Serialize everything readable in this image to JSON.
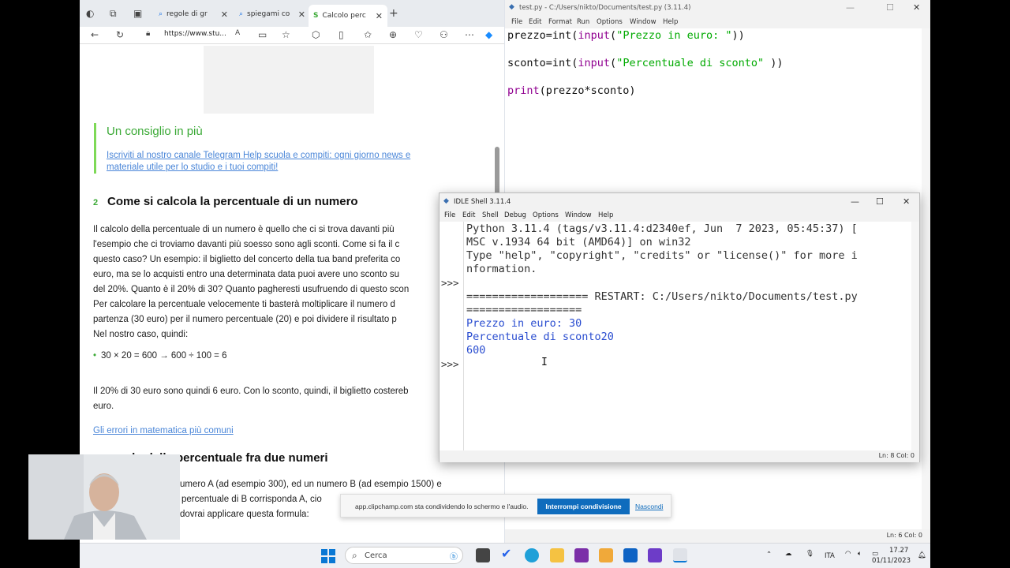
{
  "browser": {
    "tabs": [
      {
        "label": "regole di gr",
        "icon": "search-icon"
      },
      {
        "label": "spiegami co",
        "icon": "search-icon"
      },
      {
        "label": "Calcolo perc",
        "icon": "studenti-logo-icon",
        "active": true
      }
    ],
    "url": "https://www.stu...",
    "article": {
      "tip_title": "Un consiglio in più",
      "tip_link_1": "Iscriviti al nostro canale Telegram Help scuola e compiti: ogni giorno news e",
      "tip_link_2": "materiale utile per lo studio e i tuoi compiti!",
      "section_number": "2",
      "section_title": "Come si calcola la percentuale di un numero",
      "paragraph_lines": [
        "Il calcolo della percentuale di un numero è quello che ci si trova davanti più",
        "l'esempio che ci troviamo davanti più soesso sono agli sconti. Come si fa il c",
        "questo caso? Un esempio: il biglietto del concerto della tua band preferita co",
        "euro, ma se lo acquisti entro una determinata data puoi avere uno sconto su",
        "del 20%. Quanto è il 20% di 30? Quanto pagheresti usufruendo di questo scon",
        "Per calcolare la percentuale velocemente ti basterà moltiplicare il numero d",
        "partenza (30 euro) per il numero percentuale (20) e poi dividere il risultato p",
        "Nel nostro caso, quindi:"
      ],
      "formula": "30 × 20 = 600 → 600 ÷ 100 = 6",
      "result_lines": [
        "Il 20% di 30 euro sono quindi 6 euro. Con lo sconto, quindi, il biglietto costereb",
        "euro."
      ],
      "errors_link": "Gli errori in matematica più comuni",
      "section3_title": "olo della percentuale fra due numeri",
      "para3_lines": [
        "umero A (ad esempio 300), ed un numero B (ad esempio 1500) e",
        "percentuale di B corrisponda A, cio",
        "dovrai applicare questa formula:"
      ]
    }
  },
  "editor": {
    "title": "test.py - C:/Users/nikto/Documents/test.py (3.11.4)",
    "menu": [
      "File",
      "Edit",
      "Format",
      "Run",
      "Options",
      "Window",
      "Help"
    ],
    "code": {
      "line1_a": "prezzo=int(",
      "line1_b": "input",
      "line1_c": "(",
      "line1_str": "\"Prezzo in euro: \"",
      "line1_d": "))",
      "line2_a": "sconto=int(",
      "line2_b": "input",
      "line2_c": "(",
      "line2_str": "\"Percentuale di sconto\"",
      "line2_d": " ))",
      "line3_a": "print",
      "line3_b": "(prezzo*sconto)"
    },
    "status": "Ln: 6   Col: 0"
  },
  "shell": {
    "title": "IDLE Shell 3.11.4",
    "menu": [
      "File",
      "Edit",
      "Shell",
      "Debug",
      "Options",
      "Window",
      "Help"
    ],
    "prompt": ">>>",
    "lines": [
      "Python 3.11.4 (tags/v3.11.4:d2340ef, Jun  7 2023, 05:45:37) [",
      "MSC v.1934 64 bit (AMD64)] on win32",
      "Type \"help\", \"copyright\", \"credits\" or \"license()\" for more i",
      "nformation.",
      "",
      "=================== RESTART: C:/Users/nikto/Documents/test.py",
      "==================",
      "Prezzo in euro: 30",
      "Percentuale di sconto20",
      "600"
    ],
    "status": "Ln: 8   Col: 0"
  },
  "share_bar": {
    "message": "app.clipchamp.com sta condividendo lo schermo e l'audio.",
    "stop_label": "Interrompi condivisione",
    "hide_label": "Nascondi"
  },
  "taskbar": {
    "search_placeholder": "Cerca",
    "language": "ITA",
    "time": "17.27",
    "date": "01/11/2023"
  }
}
